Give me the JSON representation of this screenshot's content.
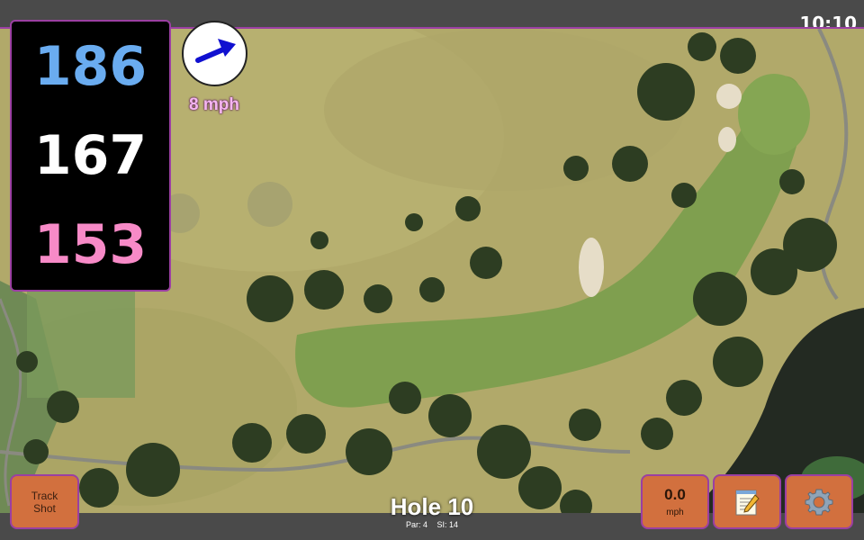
{
  "status": {
    "time": "10:10"
  },
  "distances": {
    "back": "186",
    "middle": "167",
    "front": "153"
  },
  "wind": {
    "speed_label": "8 mph",
    "direction_icon": "arrow-icon"
  },
  "hole": {
    "title": "Hole 10",
    "par": "Par: 4",
    "si": "SI: 14"
  },
  "buttons": {
    "track_line1": "Track",
    "track_line2": "Shot",
    "speed_value": "0.0",
    "speed_unit": "mph",
    "notes_icon": "notepad-icon",
    "settings_icon": "gear-icon"
  },
  "colors": {
    "back_distance": "#6aacf0",
    "middle_distance": "#ffffff",
    "front_distance": "#f78ac7",
    "button_bg": "#d2703e",
    "accent_border": "#9b3fa2",
    "wind_arrow": "#1010d0"
  }
}
